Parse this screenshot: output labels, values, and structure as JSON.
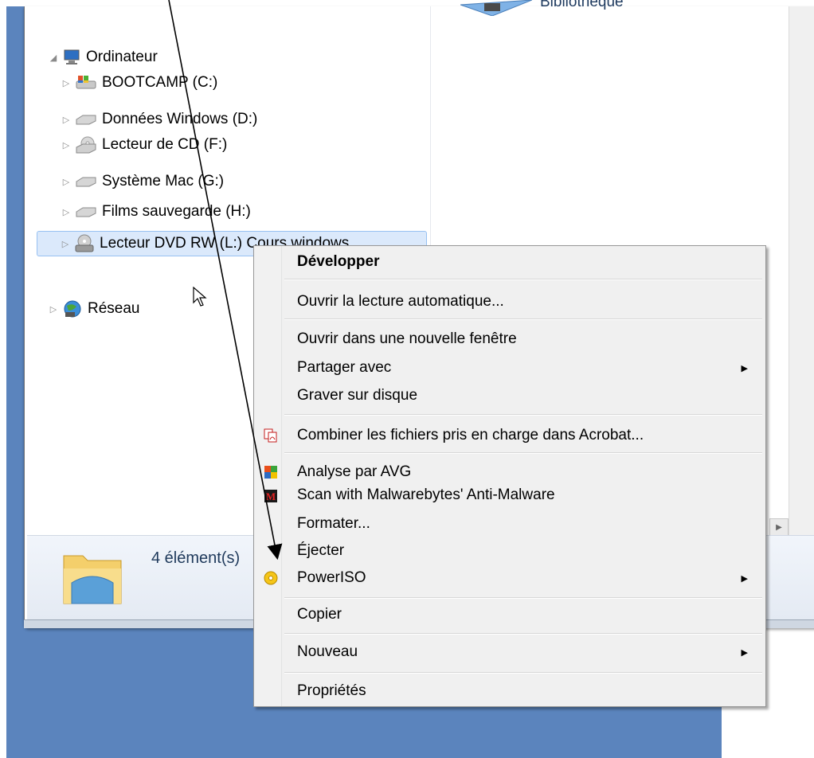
{
  "content": {
    "library_label": "Bibliothèque"
  },
  "tree": {
    "root_label": "Ordinateur",
    "items": [
      {
        "label": "BOOTCAMP (C:)",
        "icon": "windows-drive-icon"
      },
      {
        "label": "Données Windows (D:)",
        "icon": "hard-drive-icon"
      },
      {
        "label": "Lecteur de CD (F:)",
        "icon": "cd-drive-icon"
      },
      {
        "label": "Système Mac (G:)",
        "icon": "hard-drive-icon"
      },
      {
        "label": "Films sauvegarde (H:)",
        "icon": "hard-drive-icon"
      },
      {
        "label": "Lecteur DVD RW (L:) Cours windows",
        "icon": "dvd-drive-icon"
      }
    ],
    "network_label": "Réseau"
  },
  "details": {
    "count_text": "4 élément(s)"
  },
  "context_menu": {
    "items": [
      {
        "label": "Développer"
      },
      {
        "label": "Ouvrir la lecture automatique..."
      },
      {
        "label": "Ouvrir dans une nouvelle fenêtre"
      },
      {
        "label": "Partager avec"
      },
      {
        "label": "Graver sur disque"
      },
      {
        "label": "Combiner les fichiers pris en charge dans Acrobat..."
      },
      {
        "label": "Analyse par AVG"
      },
      {
        "label": "Scan with Malwarebytes' Anti-Malware"
      },
      {
        "label": "Formater..."
      },
      {
        "label": "Éjecter"
      },
      {
        "label": "PowerISO"
      },
      {
        "label": "Copier"
      },
      {
        "label": "Nouveau"
      },
      {
        "label": "Propriétés"
      }
    ]
  },
  "colors": {
    "desktop_blue": "#5b84bd",
    "selection": "#dbe9fb",
    "menu_bg": "#f0f0f0"
  }
}
